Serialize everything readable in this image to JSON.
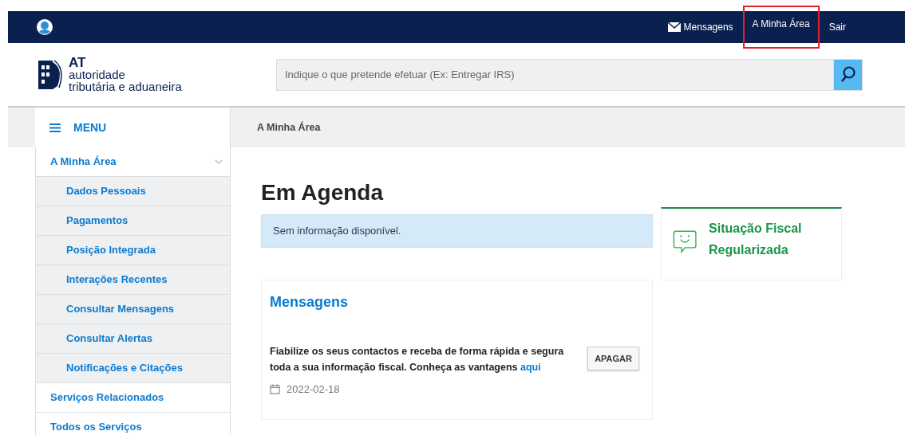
{
  "top_bar": {
    "links": [
      {
        "kind": "messages",
        "label": "Mensagens",
        "highlighted": false
      },
      {
        "kind": "plain",
        "label": "A Minha Área",
        "highlighted": true
      },
      {
        "kind": "plain",
        "label": "Sair",
        "highlighted": false
      }
    ]
  },
  "logo": {
    "line_1": "AT",
    "line_2": "autoridade",
    "line_3": "tributária e aduaneira"
  },
  "search": {
    "placeholder": "Indique o que pretende efetuar (Ex: Entregar IRS)"
  },
  "menu": {
    "label": "MENU"
  },
  "breadcrumb": "A Minha Área",
  "sidebar": {
    "items": [
      {
        "label": "A Minha Área",
        "expanded": true,
        "children": [
          {
            "label": "Dados Pessoais"
          },
          {
            "label": "Pagamentos"
          },
          {
            "label": "Posição Integrada"
          },
          {
            "label": "Interações Recentes"
          },
          {
            "label": "Consultar Mensagens"
          },
          {
            "label": "Consultar Alertas"
          },
          {
            "label": "Notificações e Citações"
          }
        ]
      },
      {
        "label": "Serviços Relacionados"
      },
      {
        "label": "Todos os Serviços"
      }
    ]
  },
  "agenda": {
    "title": "Em Agenda",
    "notice": "Sem informação disponível."
  },
  "status_card": {
    "text": "Situação Fiscal Regularizada"
  },
  "messages": {
    "title": "Mensagens",
    "items": [
      {
        "text": "Fiabilize os seus contactos e receba de forma rápida e segura toda a sua informação fiscal. Conheça as vantagens",
        "link": "aqui",
        "date": "2022-02-18",
        "button": "APAGAR"
      }
    ]
  }
}
